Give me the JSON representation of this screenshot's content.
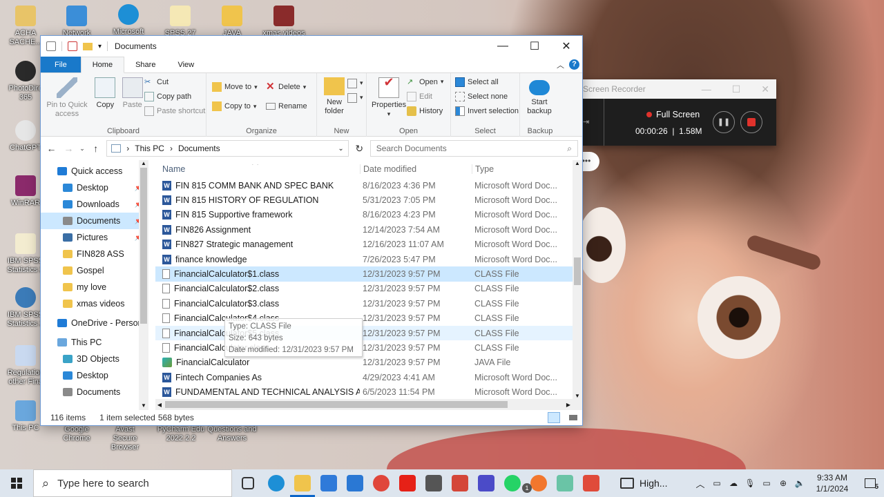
{
  "desktop": {
    "left_icons": [
      {
        "label": "ACHA SACHE...",
        "color": "#e8c468"
      },
      {
        "label": "PhotoDire 365",
        "color": "#2a2a2a"
      },
      {
        "label": "ChatGPT",
        "color": "#e6e6e6"
      },
      {
        "label": "WinRAR",
        "color": "#8b2a6b"
      },
      {
        "label": "IBM SPSS Statistics 2",
        "color": "#f3ecd0"
      },
      {
        "label": "IBM SPSS Statistics 2",
        "color": "#3b7bb8"
      },
      {
        "label": "Regulation other Fina",
        "color": "#c9d9f0"
      },
      {
        "label": "This PC",
        "color": "#6aa7dd"
      }
    ],
    "top_icons": [
      "Network",
      "Microsoft",
      "SPSS 27",
      "JAVA",
      "xmas videos"
    ],
    "bottom_icons": [
      "Google Chrome",
      "Avast Secure Browser",
      "PyCharm Edu 2022.2.2",
      "Questions and Answers"
    ]
  },
  "window": {
    "title": "Documents",
    "tabs": {
      "file": "File",
      "home": "Home",
      "share": "Share",
      "view": "View"
    },
    "help": "?",
    "ribbon": {
      "clipboard": {
        "pin": "Pin to Quick access",
        "copy": "Copy",
        "paste": "Paste",
        "cut": "Cut",
        "copy_path": "Copy path",
        "paste_shortcut": "Paste shortcut",
        "name": "Clipboard"
      },
      "organize": {
        "move_to": "Move to",
        "copy_to": "Copy to",
        "delete": "Delete",
        "rename": "Rename",
        "name": "Organize"
      },
      "new": {
        "new_folder": "New folder",
        "name": "New"
      },
      "open": {
        "properties": "Properties",
        "open": "Open",
        "edit": "Edit",
        "history": "History",
        "name": "Open"
      },
      "select": {
        "select_all": "Select all",
        "select_none": "Select none",
        "invert": "Invert selection",
        "name": "Select"
      },
      "backup": {
        "start": "Start backup",
        "name": "Backup"
      }
    },
    "address": {
      "this_pc": "This PC",
      "folder": "Documents",
      "search_placeholder": "Search Documents"
    },
    "nav": [
      {
        "label": "Quick access",
        "indent": 0,
        "pin": false,
        "color": "#1f7bd6"
      },
      {
        "label": "Desktop",
        "indent": 1,
        "pin": true,
        "color": "#2b88d8"
      },
      {
        "label": "Downloads",
        "indent": 1,
        "pin": true,
        "color": "#2b88d8"
      },
      {
        "label": "Documents",
        "indent": 1,
        "pin": true,
        "color": "#8a8a8a",
        "selected": true
      },
      {
        "label": "Pictures",
        "indent": 1,
        "pin": true,
        "color": "#3a6ea5"
      },
      {
        "label": "FIN828 ASS",
        "indent": 1,
        "pin": false,
        "color": "#f0c44c"
      },
      {
        "label": "Gospel",
        "indent": 1,
        "pin": false,
        "color": "#f0c44c"
      },
      {
        "label": "my love",
        "indent": 1,
        "pin": false,
        "color": "#f0c44c"
      },
      {
        "label": "xmas videos",
        "indent": 1,
        "pin": false,
        "color": "#f0c44c"
      },
      {
        "label": "OneDrive - Person",
        "indent": 0,
        "pin": false,
        "color": "#1f7bd6"
      },
      {
        "label": "This PC",
        "indent": 0,
        "pin": false,
        "color": "#6aa7dd"
      },
      {
        "label": "3D Objects",
        "indent": 1,
        "pin": false,
        "color": "#3aa3c7"
      },
      {
        "label": "Desktop",
        "indent": 1,
        "pin": false,
        "color": "#2b88d8"
      },
      {
        "label": "Documents",
        "indent": 1,
        "pin": false,
        "color": "#8a8a8a"
      }
    ],
    "columns": {
      "name": "Name",
      "date": "Date modified",
      "type": "Type"
    },
    "files": [
      {
        "name": "FIN 815 COMM BANK AND SPEC BANK",
        "date": "8/16/2023 4:36 PM",
        "type": "Microsoft Word Doc...",
        "icon": "word"
      },
      {
        "name": "FIN 815 HISTORY OF REGULATION",
        "date": "5/31/2023 7:05 PM",
        "type": "Microsoft Word Doc...",
        "icon": "word"
      },
      {
        "name": "FIN 815 Supportive framework",
        "date": "8/16/2023 4:23 PM",
        "type": "Microsoft Word Doc...",
        "icon": "word"
      },
      {
        "name": "FIN826 Assignment",
        "date": "12/14/2023 7:54 AM",
        "type": "Microsoft Word Doc...",
        "icon": "word"
      },
      {
        "name": "FIN827 Strategic management",
        "date": "12/16/2023 11:07 AM",
        "type": "Microsoft Word Doc...",
        "icon": "word"
      },
      {
        "name": "finance knowledge",
        "date": "7/26/2023 5:47 PM",
        "type": "Microsoft Word Doc...",
        "icon": "word"
      },
      {
        "name": "FinancialCalculator$1.class",
        "date": "12/31/2023 9:57 PM",
        "type": "CLASS File",
        "icon": "file",
        "state": "sel"
      },
      {
        "name": "FinancialCalculator$2.class",
        "date": "12/31/2023 9:57 PM",
        "type": "CLASS File",
        "icon": "file"
      },
      {
        "name": "FinancialCalculator$3.class",
        "date": "12/31/2023 9:57 PM",
        "type": "CLASS File",
        "icon": "file"
      },
      {
        "name": "FinancialCalculator$4.class",
        "date": "12/31/2023 9:57 PM",
        "type": "CLASS File",
        "icon": "file"
      },
      {
        "name": "FinancialCalculator$5.class",
        "date": "12/31/2023 9:57 PM",
        "type": "CLASS File",
        "icon": "file",
        "state": "hov"
      },
      {
        "name": "FinancialCalculator.class",
        "date": "12/31/2023 9:57 PM",
        "type": "CLASS File",
        "icon": "file"
      },
      {
        "name": "FinancialCalculator",
        "date": "12/31/2023 9:57 PM",
        "type": "JAVA File",
        "icon": "java"
      },
      {
        "name": "Fintech Companies As",
        "date": "4/29/2023 4:41 AM",
        "type": "Microsoft Word Doc...",
        "icon": "word"
      },
      {
        "name": "FUNDAMENTAL AND TECHNICAL ANALYSIS AN...",
        "date": "6/5/2023 11:54 PM",
        "type": "Microsoft Word Doc...",
        "icon": "word"
      }
    ],
    "tooltip": {
      "type": "Type: CLASS File",
      "size": "Size: 643 bytes",
      "date": "Date modified: 12/31/2023 9:57 PM"
    },
    "status": {
      "items": "116 items",
      "selected": "1 item selected",
      "size": "568 bytes"
    }
  },
  "recorder": {
    "title": "Screen Recorder",
    "mode": "Full Screen",
    "time": "00:00:26",
    "size": "1.58M"
  },
  "taskbar": {
    "search_placeholder": "Type here to search",
    "apps": [
      {
        "name": "task-view",
        "color": "#333"
      },
      {
        "name": "edge",
        "color": "#1d8fd6"
      },
      {
        "name": "file-explorer",
        "color": "#f0c44c"
      },
      {
        "name": "store",
        "color": "#2f7ad9"
      },
      {
        "name": "mail",
        "color": "#2a78d4"
      },
      {
        "name": "chrome",
        "color": "#e0463b"
      },
      {
        "name": "youtube",
        "color": "#e62117"
      },
      {
        "name": "camera",
        "color": "#555"
      },
      {
        "name": "gmail",
        "color": "#d44638"
      },
      {
        "name": "notes",
        "color": "#4b4bc8"
      },
      {
        "name": "whatsapp",
        "color": "#25d366"
      },
      {
        "name": "brave",
        "color": "#f2772e"
      },
      {
        "name": "app-green",
        "color": "#6ac4a6"
      },
      {
        "name": "recorder",
        "color": "#e04b3a"
      }
    ],
    "whatsapp_badge": "1",
    "weather": "High...",
    "time": "9:33 AM",
    "date": "1/1/2024",
    "notif_count": "5"
  }
}
